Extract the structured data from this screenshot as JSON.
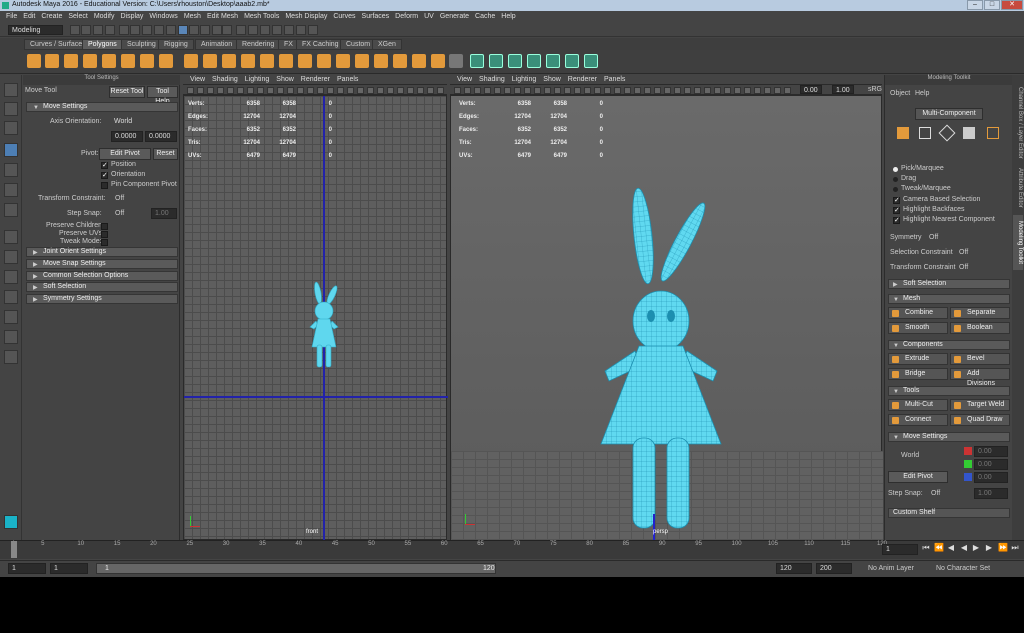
{
  "window": {
    "title": "Autodesk Maya 2016 - Educational Version: C:\\Users\\rhouston\\Desktop\\aaab2.mb*"
  },
  "menubar": [
    "File",
    "Edit",
    "Create",
    "Select",
    "Modify",
    "Display",
    "Windows",
    "Mesh",
    "Edit Mesh",
    "Mesh Tools",
    "Mesh Display",
    "Curves",
    "Surfaces",
    "Deform",
    "UV",
    "Generate",
    "Cache",
    "Help"
  ],
  "status": {
    "menuset": "Modeling"
  },
  "shelf_tabs": [
    "Curves / Surfaces",
    "Polygons",
    "Sculpting",
    "Rigging",
    "Animation",
    "Rendering",
    "FX",
    "FX Caching",
    "Custom",
    "XGen"
  ],
  "shelf_active": "Polygons",
  "tool_settings": {
    "panel_title": "Tool Settings",
    "tool_name": "Move Tool",
    "reset_tool": "Reset Tool",
    "tool_help": "Tool Help",
    "move_settings": "Move Settings",
    "axis_orientation_label": "Axis Orientation:",
    "axis_orientation_value": "World",
    "val1": "0.0000",
    "val2": "0.0000",
    "pivot_label": "Pivot:",
    "edit_pivot": "Edit Pivot",
    "reset": "Reset",
    "position": "Position",
    "orientation": "Orientation",
    "pin_component_pivot": "Pin Component Pivot",
    "transform_constraint_label": "Transform Constraint:",
    "transform_constraint_value": "Off",
    "step_snap_label": "Step Snap:",
    "step_snap_value": "Off",
    "step_snap_num": "1.00",
    "preserve_children": "Preserve Children:",
    "preserve_uvs": "Preserve UVs:",
    "tweak_mode": "Tweak Mode:",
    "sections": [
      "Joint Orient Settings",
      "Move Snap Settings",
      "Common Selection Options",
      "Soft Selection",
      "Symmetry Settings"
    ]
  },
  "viewport_menu": [
    "View",
    "Shading",
    "Lighting",
    "Show",
    "Renderer",
    "Panels"
  ],
  "hud": {
    "rows": [
      {
        "label": "Verts:",
        "a": "6358",
        "b": "6358",
        "c": "0"
      },
      {
        "label": "Edges:",
        "a": "12704",
        "b": "12704",
        "c": "0"
      },
      {
        "label": "Faces:",
        "a": "6352",
        "b": "6352",
        "c": "0"
      },
      {
        "label": "Tris:",
        "a": "12704",
        "b": "12704",
        "c": "0"
      },
      {
        "label": "UVs:",
        "a": "6479",
        "b": "6479",
        "c": "0"
      }
    ]
  },
  "viewport_left_label": "front",
  "viewport_right_label": "persp",
  "viewport_fields": {
    "v1": "0.00",
    "v2": "1.00",
    "srgb": "sRG"
  },
  "modeling_toolkit": {
    "title": "Modeling Toolkit",
    "object": "Object",
    "help": "Help",
    "multi_component": "Multi-Component",
    "pick_marquee": "Pick/Marquee",
    "drag": "Drag",
    "tweak_marquee": "Tweak/Marquee",
    "camera_based": "Camera Based Selection",
    "highlight_backfaces": "Highlight Backfaces",
    "highlight_nearest": "Highlight Nearest Component",
    "symmetry_label": "Symmetry",
    "symmetry_value": "Off",
    "selection_constraint_label": "Selection Constraint",
    "selection_constraint_value": "Off",
    "transform_constraint_label": "Transform Constraint",
    "transform_constraint_value": "Off",
    "soft_selection": "Soft Selection",
    "mesh": "Mesh",
    "combine": "Combine",
    "separate": "Separate",
    "smooth": "Smooth",
    "boolean": "Boolean",
    "components": "Components",
    "extrude": "Extrude",
    "bevel": "Bevel",
    "bridge": "Bridge",
    "add_divisions": "Add Divisions",
    "tools": "Tools",
    "multi_cut": "Multi-Cut",
    "target_weld": "Target Weld",
    "connect": "Connect",
    "quad_draw": "Quad Draw",
    "move_settings": "Move Settings",
    "world": "World",
    "edit_pivot": "Edit Pivot",
    "x": "0.00",
    "y": "0.00",
    "z": "0.00",
    "step_snap_label": "Step Snap:",
    "step_snap_value": "Off",
    "step_snap_num": "1.00",
    "custom_shelf": "Custom Shelf"
  },
  "side_tabs": [
    "Channel Box / Layer Editor",
    "Attribute Editor",
    "Modeling Toolkit"
  ],
  "timeline": {
    "ticks": [
      "1",
      "5",
      "10",
      "15",
      "20",
      "25",
      "30",
      "35",
      "40",
      "45",
      "50",
      "55",
      "60",
      "65",
      "70",
      "75",
      "80",
      "85",
      "90",
      "95",
      "100",
      "105",
      "110",
      "115",
      "120"
    ],
    "current_frame": "1"
  },
  "range": {
    "start": "1",
    "start2": "1",
    "slider_start": "1",
    "slider_end": "120",
    "end": "120",
    "end2": "200",
    "anim_layer": "No Anim Layer",
    "character_set": "No Character Set"
  }
}
